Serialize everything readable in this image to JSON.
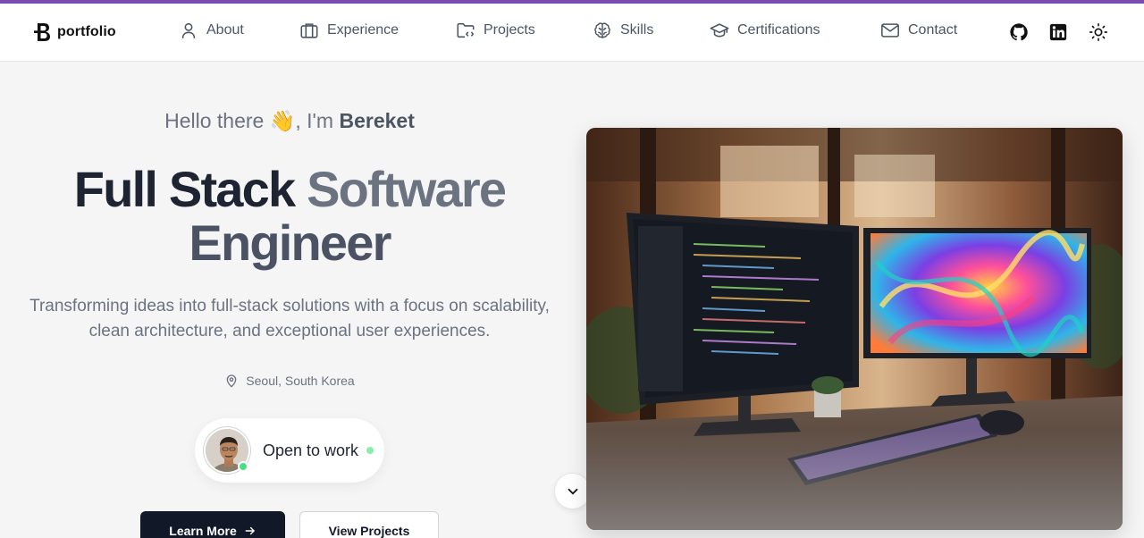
{
  "brand": {
    "name": "portfolio",
    "accent_color": "#7b4bb1"
  },
  "nav": {
    "items": [
      {
        "label": "About",
        "icon": "user-icon"
      },
      {
        "label": "Experience",
        "icon": "briefcase-icon"
      },
      {
        "label": "Projects",
        "icon": "folder-code-icon"
      },
      {
        "label": "Skills",
        "icon": "brain-icon"
      },
      {
        "label": "Certifications",
        "icon": "graduation-cap-icon"
      },
      {
        "label": "Contact",
        "icon": "mail-icon"
      }
    ],
    "actions": [
      "github-icon",
      "linkedin-icon",
      "sun-icon"
    ]
  },
  "hero": {
    "greeting_prefix": "Hello there",
    "greeting_emoji": "👋",
    "greeting_mid": ", I'm",
    "name": "Bereket",
    "title_word1": "Full Stack",
    "title_word2": "Software",
    "title_line2": "Engineer",
    "subtitle": "Transforming ideas into full-stack solutions with a focus on scalability, clean architecture, and exceptional user experiences.",
    "location": "Seoul, South Korea",
    "status": "Open to work",
    "status_color": "#4ade80",
    "primary_button": "Learn More",
    "secondary_button": "View Projects"
  }
}
